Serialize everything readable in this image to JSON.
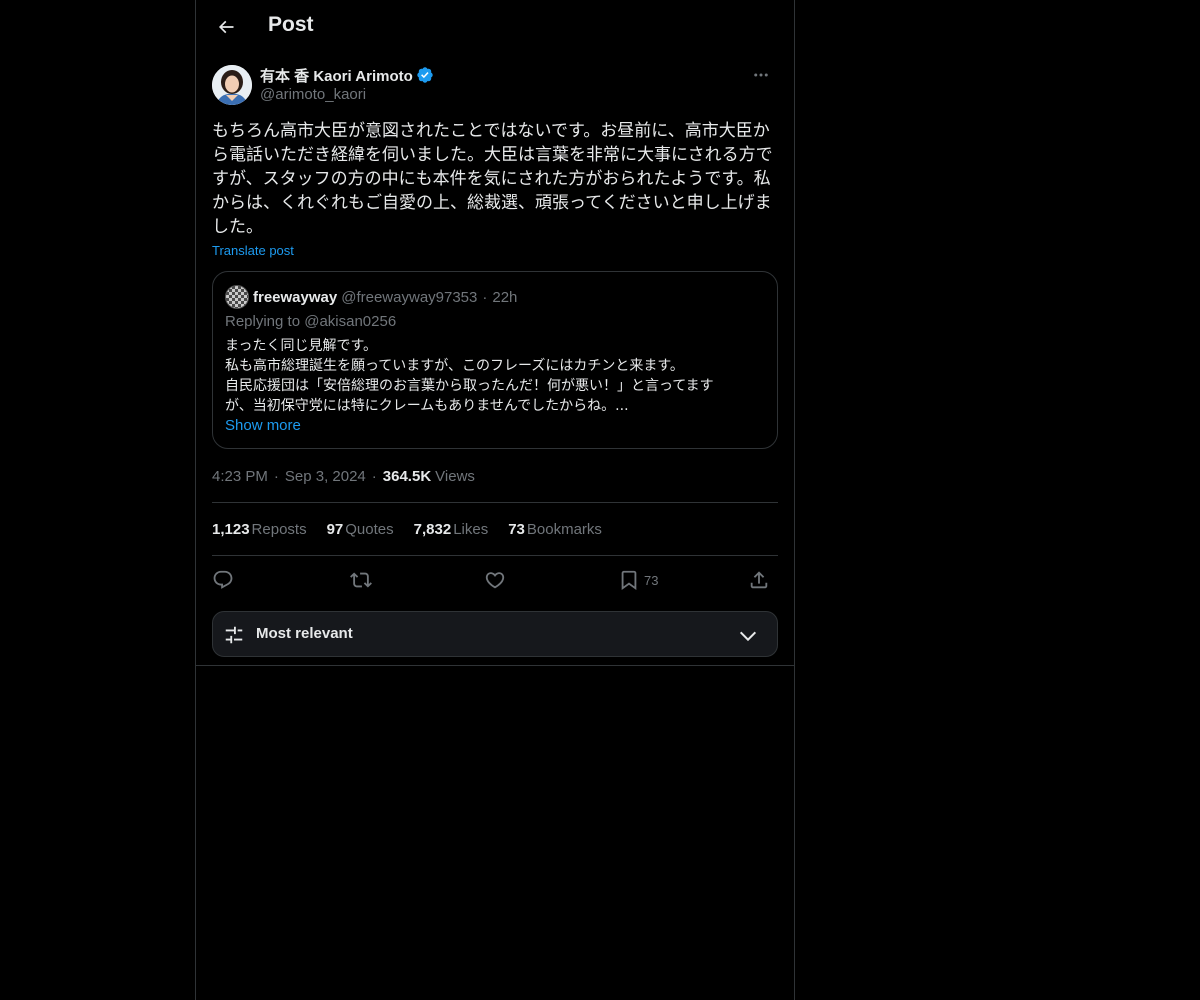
{
  "header": {
    "title": "Post"
  },
  "author": {
    "display_name": "有本 香 Kaori Arimoto",
    "handle": "@arimoto_kaori",
    "verified": true
  },
  "post": {
    "text": "もちろん高市大臣が意図されたことではないです。お昼前に、高市大臣から電話いただき経緯を伺いました。大臣は言葉を非常に大事にされる方ですが、スタッフの方の中にも本件を気にされた方がおられたようです。私からは、くれぐれもご自愛の上、総裁選、頑張ってくださいと申し上げました。",
    "translate_label": "Translate post",
    "time": "4:23 PM",
    "date": "Sep 3, 2024",
    "views_count": "364.5K",
    "views_label": "Views"
  },
  "quote": {
    "name": "freewayway",
    "handle": "@freewayway97353",
    "time": "22h",
    "replying_prefix": "Replying to",
    "replying_to": "@akisan0256",
    "lines": [
      "まったく同じ見解です。",
      "私も高市総理誕生を願っていますが、このフレーズにはカチンと来ます。",
      "自民応援団は「安倍総理のお言葉から取ったんだ！何が悪い！」と言ってます",
      "が、当初保守党には特にクレームもありませんでしたからね。..."
    ],
    "show_more": "Show more"
  },
  "stats": {
    "reposts": {
      "count": "1,123",
      "label": "Reposts"
    },
    "quotes": {
      "count": "97",
      "label": "Quotes"
    },
    "likes": {
      "count": "7,832",
      "label": "Likes"
    },
    "bookmarks": {
      "count": "73",
      "label": "Bookmarks"
    }
  },
  "actions": {
    "reply_icon": "reply-icon",
    "repost_icon": "repost-icon",
    "like_icon": "heart-icon",
    "bookmark_icon": "bookmark-icon",
    "bookmark_count": "73",
    "share_icon": "share-icon"
  },
  "sort": {
    "label": "Most relevant"
  },
  "colors": {
    "accent": "#1d9bf0",
    "muted": "#71767b",
    "text": "#e7e9ea",
    "border": "#2f3336",
    "background": "#000000"
  }
}
